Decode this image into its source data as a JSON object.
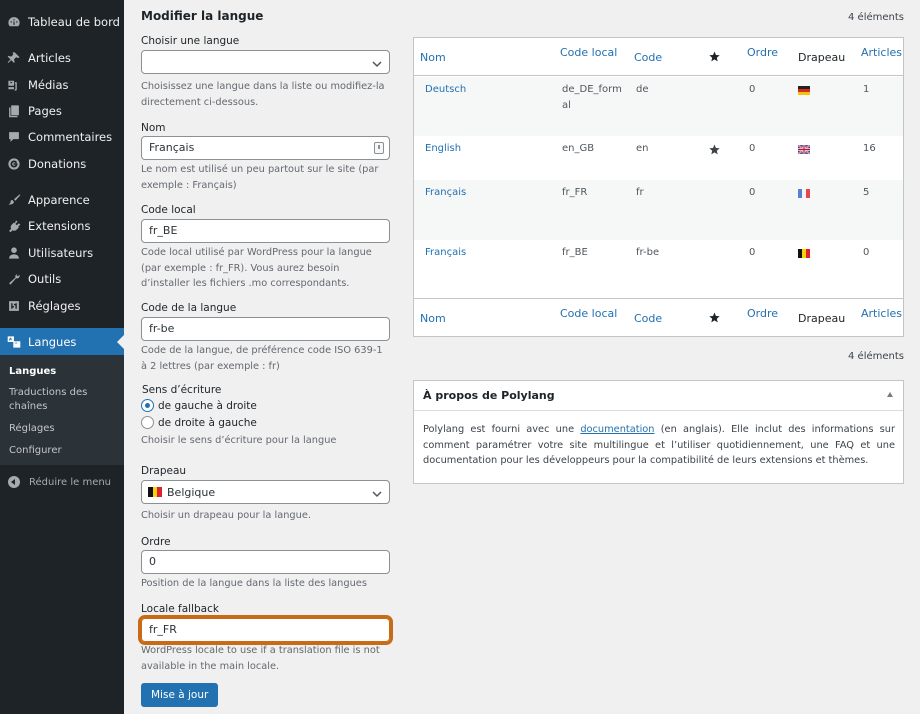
{
  "sidebar": {
    "items": [
      {
        "label": "Tableau de bord",
        "icon": "dashboard-icon"
      },
      {
        "label": "Articles",
        "icon": "pushpin-icon"
      },
      {
        "label": "Médias",
        "icon": "media-icon"
      },
      {
        "label": "Pages",
        "icon": "pages-icon"
      },
      {
        "label": "Commentaires",
        "icon": "comment-icon"
      },
      {
        "label": "Donations",
        "icon": "donation-icon"
      },
      {
        "label": "Apparence",
        "icon": "paintbrush-icon"
      },
      {
        "label": "Extensions",
        "icon": "plugin-icon"
      },
      {
        "label": "Utilisateurs",
        "icon": "user-icon"
      },
      {
        "label": "Outils",
        "icon": "wrench-icon"
      },
      {
        "label": "Réglages",
        "icon": "settings-icon"
      },
      {
        "label": "Langues",
        "icon": "translation-icon"
      }
    ],
    "submenu": [
      {
        "label": "Langues"
      },
      {
        "label": "Traductions des chaînes"
      },
      {
        "label": "Réglages"
      },
      {
        "label": "Configurer"
      }
    ],
    "collapse_label": "Réduire le menu"
  },
  "form": {
    "title": "Modifier la langue",
    "choose_language": {
      "label": "Choisir une langue",
      "value": "",
      "description": "Choisissez une langue dans la liste ou modifiez-la directement ci-dessous."
    },
    "name": {
      "label": "Nom",
      "value": "Français",
      "description": "Le nom est utilisé un peu partout sur le site (par exemple : Français)"
    },
    "locale": {
      "label": "Code local",
      "value": "fr_BE",
      "description": "Code local utilisé par WordPress pour la langue (par exemple : fr_FR). Vous aurez besoin d’installer les fichiers .mo correspondants."
    },
    "language_code": {
      "label": "Code de la langue",
      "value": "fr-be",
      "description": "Code de la langue, de préférence code ISO 639-1 à 2 lettres (par exemple : fr)"
    },
    "direction": {
      "label": "Sens d’écriture",
      "options": [
        "de gauche à droite",
        "de droite à gauche"
      ],
      "selected": "de gauche à droite",
      "description": "Choisir le sens d’écriture pour la langue"
    },
    "flag": {
      "label": "Drapeau",
      "value": "Belgique",
      "description": "Choisir un drapeau pour la langue."
    },
    "order": {
      "label": "Ordre",
      "value": "0",
      "description": "Position de la langue dans la liste des langues"
    },
    "fallback": {
      "label": "Locale fallback",
      "value": "fr_FR",
      "description": "WordPress locale to use if a translation file is not available in the main locale."
    },
    "submit_label": "Mise à jour"
  },
  "table": {
    "count_label": "4 éléments",
    "columns": {
      "name": "Nom",
      "locale": "Code local",
      "code": "Code",
      "default": "star-icon",
      "order": "Ordre",
      "flag": "Drapeau",
      "posts": "Articles"
    },
    "rows": [
      {
        "name": "Deutsch",
        "locale": "de_DE_formal",
        "code": "de",
        "default": false,
        "order": "0",
        "flag": "de",
        "posts": "1"
      },
      {
        "name": "English",
        "locale": "en_GB",
        "code": "en",
        "default": true,
        "order": "0",
        "flag": "gb",
        "posts": "16"
      },
      {
        "name": "Français",
        "locale": "fr_FR",
        "code": "fr",
        "default": false,
        "order": "0",
        "flag": "fr",
        "posts": "5"
      },
      {
        "name": "Français",
        "locale": "fr_BE",
        "code": "fr-be",
        "default": false,
        "order": "0",
        "flag": "be",
        "posts": "0"
      }
    ]
  },
  "about": {
    "title": "À propos de Polylang",
    "text_before": "Polylang est fourni avec une ",
    "link": "documentation",
    "text_after": " (en anglais). Elle inclut des informations sur comment paramétrer votre site multilingue et l’utiliser quotidiennement, une FAQ et une documentation pour les développeurs pour la compatibilité de leurs extensions et thèmes."
  },
  "colors": {
    "accent": "#2271b1",
    "sidebar_bg": "#1d2327",
    "highlight": "#c86a16"
  }
}
